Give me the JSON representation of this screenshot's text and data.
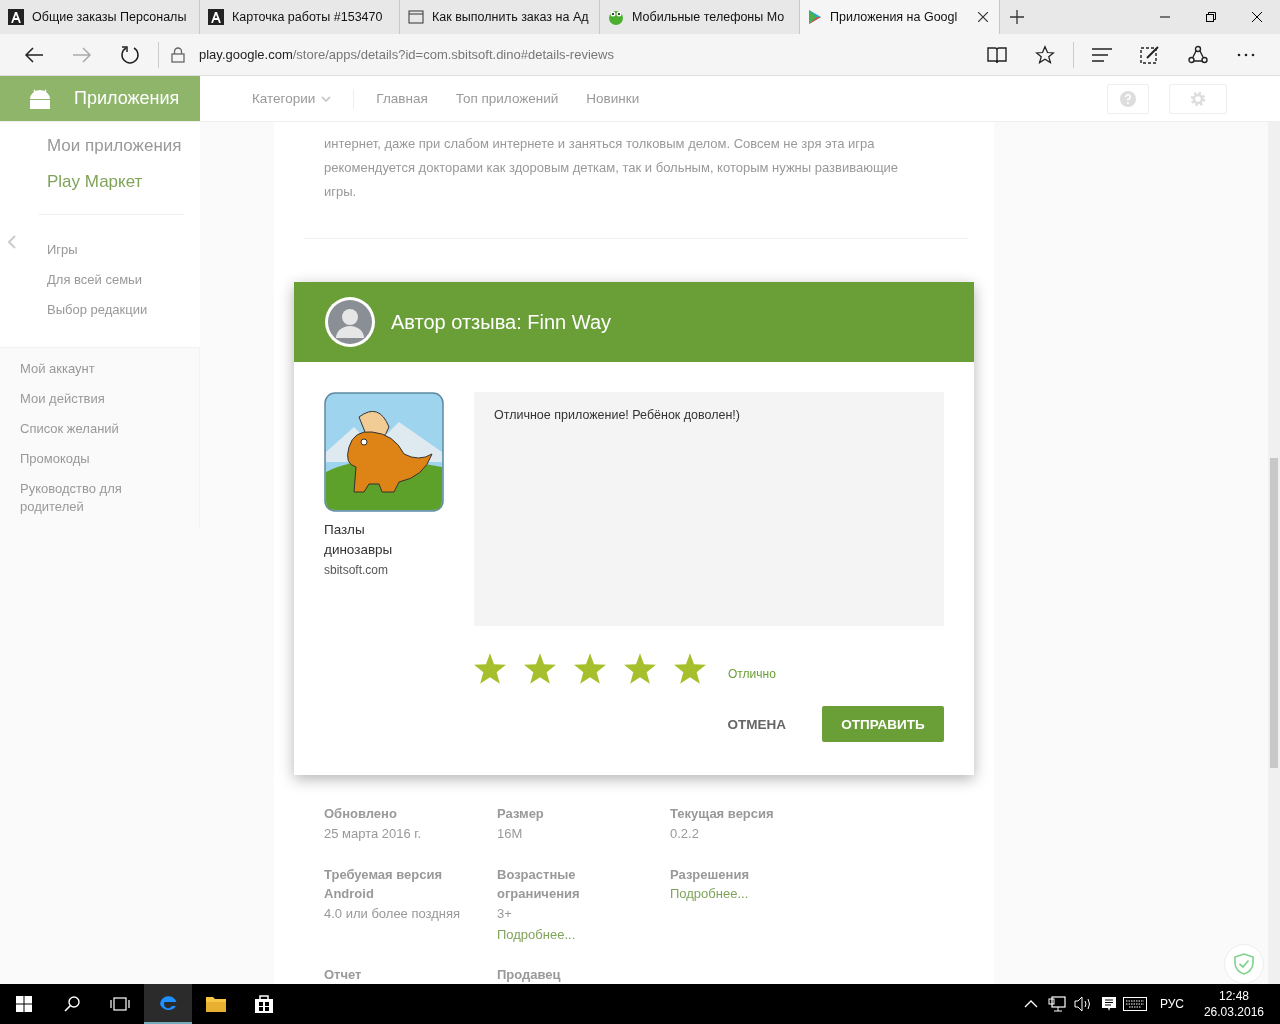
{
  "browser": {
    "tabs": [
      {
        "title": "Общие заказы Персоналы",
        "kind": "site-a",
        "selected": false
      },
      {
        "title": "Карточка работы #153470",
        "kind": "site-a",
        "selected": false
      },
      {
        "title": "Как выполнить заказ на Ад",
        "kind": "page",
        "selected": false
      },
      {
        "title": "Мобильные телефоны Мо",
        "kind": "avatar",
        "selected": false
      },
      {
        "title": "Приложения на Googl",
        "kind": "store",
        "selected": true
      }
    ],
    "address_host": "play.google.com",
    "address_path": "/store/apps/details?id=com.sbitsoft.dino#details-reviews"
  },
  "store_header": {
    "brand": "Приложения",
    "nav": [
      {
        "label": "Категории",
        "dropdown": true
      },
      {
        "label": "Главная",
        "dropdown": false
      },
      {
        "label": "Топ приложений",
        "dropdown": false
      },
      {
        "label": "Новинки",
        "dropdown": false
      }
    ]
  },
  "sidebar": {
    "my_apps": "Мои приложения",
    "store": "Play Маркет",
    "categories": [
      "Игры",
      "Для всей семьи",
      "Выбор редакции"
    ],
    "account_links": [
      "Мой аккаунт",
      "Мои действия",
      "Список желаний",
      "Промокоды",
      "Руководство для родителей"
    ]
  },
  "description": "интернет, даже при слабом интернете и заняться толковым делом. Совсем не зря эта игра рекомендуется докторами как здоровым деткам, так и больным, которым нужны развивающие игры.",
  "details": [
    {
      "label": "Обновлено",
      "value": "25 марта 2016 г."
    },
    {
      "label": "Размер",
      "value": "16M"
    },
    {
      "label": "Текущая версия",
      "value": "0.2.2"
    },
    {
      "label": "Требуемая версия Android",
      "value": "4.0 или более поздняя"
    },
    {
      "label": "Возрастные ограничения",
      "value": "3+",
      "link": "Подробнее..."
    },
    {
      "label": "Разрешения",
      "link": "Подробнее..."
    },
    {
      "label": "Отчет"
    },
    {
      "label": "Продавец"
    }
  ],
  "review_dialog": {
    "title": "Автор отзыва: Finn Way",
    "app_name": "Пазлы динозавры",
    "developer": "sbitsoft.com",
    "text": "Отличное приложение! Ребёнок доволен!)",
    "stars": 5,
    "rating_label": "Отлично",
    "cancel": "ОТМЕНА",
    "submit": "ОТПРАВИТЬ"
  },
  "taskbar": {
    "language": "РУС",
    "time": "12:48",
    "date": "26.03.2016"
  }
}
